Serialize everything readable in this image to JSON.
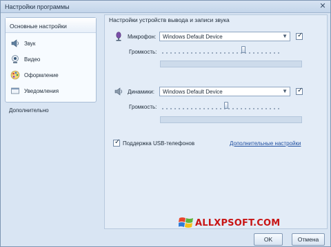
{
  "window": {
    "title": "Настройки программы",
    "close_glyph": "✕"
  },
  "nav": {
    "header": "Основные настройки",
    "items": [
      {
        "label": "Звук",
        "icon": "speaker-icon"
      },
      {
        "label": "Видео",
        "icon": "webcam-icon"
      },
      {
        "label": "Оформление",
        "icon": "palette-icon"
      },
      {
        "label": "Уведомления",
        "icon": "notification-icon"
      }
    ],
    "extra": "Дополнительно"
  },
  "main": {
    "section_title": "Настройки устройств вывода и записи звука",
    "microphone": {
      "label": "Микрофон:",
      "device": "Windows Default Device",
      "checked": true,
      "volume_label": "Громкость:",
      "volume": 0.68
    },
    "speakers": {
      "label": "Динамики:",
      "device": "Windows Default Device",
      "checked": true,
      "volume_label": "Громкость:",
      "volume": 0.54
    },
    "usb": {
      "label": "Поддержка USB-телефонов",
      "checked": true
    },
    "advanced_link": "Дополнительные настройки"
  },
  "footer": {
    "ok": "OK",
    "cancel": "Отмена"
  },
  "watermark": {
    "text": "ALLXPSOFT.COM",
    "color": "#c81414"
  },
  "colors": {
    "accent": "#1f4fa0",
    "panel": "#e3ecf7",
    "window": "#d9e5f3"
  }
}
